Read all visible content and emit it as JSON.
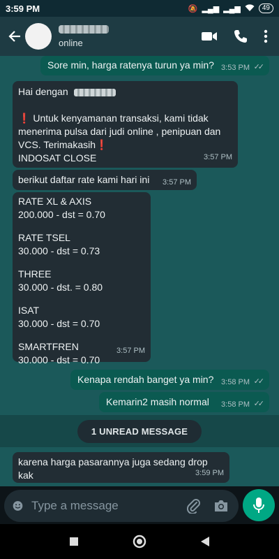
{
  "status_bar": {
    "time": "3:59 PM",
    "battery": "49"
  },
  "header": {
    "status": "online"
  },
  "messages": [
    {
      "dir": "out",
      "text": "Sore min, harga ratenya turun ya min?",
      "time": "3:53 PM"
    },
    {
      "dir": "in",
      "greeting": "Hai dengan",
      "line1": "Untuk kenyamanan transaksi, kami tidak",
      "line2": "menerima pulsa dari judi online , penipuan dan",
      "line3": "VCS. Terimakasih",
      "line4": "INDOSAT CLOSE",
      "time": "3:57 PM"
    },
    {
      "dir": "in",
      "text": "berikut daftar rate kami hari ini",
      "time": "3:57 PM"
    },
    {
      "dir": "in",
      "lines": [
        "RATE XL & AXIS",
        "200.000 - dst = 0.70",
        "",
        "RATE TSEL",
        "30.000 - dst = 0.73",
        "",
        "THREE",
        "30.000 - dst. = 0.80",
        "",
        "ISAT",
        "30.000 - dst = 0.70",
        "",
        "SMARTFREN",
        "30.000 - dst = 0.70"
      ],
      "time": "3:57 PM"
    },
    {
      "dir": "out",
      "text": "Kenapa rendah banget ya min?",
      "time": "3:58 PM"
    },
    {
      "dir": "out",
      "text": "Kemarin2 masih normal",
      "time": "3:58 PM"
    },
    {
      "dir": "in",
      "text": "karena harga pasarannya juga sedang drop kak",
      "time": "3:59 PM"
    }
  ],
  "unread_label": "1 UNREAD MESSAGE",
  "composer": {
    "placeholder": "Type a message"
  },
  "icons": {
    "back": "arrow-left-icon",
    "video": "video-call-icon",
    "call": "phone-icon",
    "menu": "more-vert-icon",
    "emoji": "emoji-icon",
    "attach": "paperclip-icon",
    "camera": "camera-icon",
    "mic": "mic-icon",
    "warning": "exclamation-icon",
    "ticks": "double-check-icon"
  },
  "colors": {
    "chat_bg": "#1b595a",
    "incoming": "#222d34",
    "outgoing": "#0b5a51",
    "accent": "#00a884",
    "header": "#1e3b43"
  }
}
